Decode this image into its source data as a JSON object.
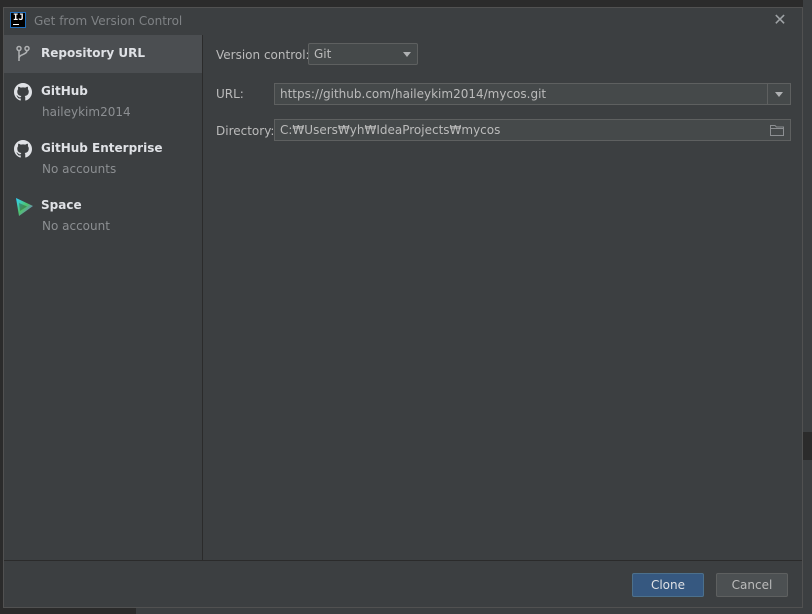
{
  "window": {
    "title": "Get from Version Control",
    "app_icon_text": "IJ"
  },
  "sidebar": {
    "items": [
      {
        "name": "Repository URL",
        "sub": "",
        "icon": "branch-icon",
        "selected": true
      },
      {
        "name": "GitHub",
        "sub": "haileykim2014",
        "icon": "github-icon"
      },
      {
        "name": "GitHub Enterprise",
        "sub": "No accounts",
        "icon": "github-icon"
      },
      {
        "name": "Space",
        "sub": "No account",
        "icon": "space-icon"
      }
    ]
  },
  "form": {
    "version_control_label": "Version control:",
    "version_control_value": "Git",
    "url_label": "URL:",
    "url_value": "https://github.com/haileykim2014/mycos.git",
    "directory_label": "Directory:",
    "directory_value": "C:₩Users₩yh₩IdeaProjects₩mycos"
  },
  "footer": {
    "clone_label": "Clone",
    "cancel_label": "Cancel"
  },
  "colors": {
    "dialog_bg": "#3c3f41",
    "selected_bg": "#4b4e51",
    "primary_button": "#365880",
    "field_bg": "#45494a"
  }
}
